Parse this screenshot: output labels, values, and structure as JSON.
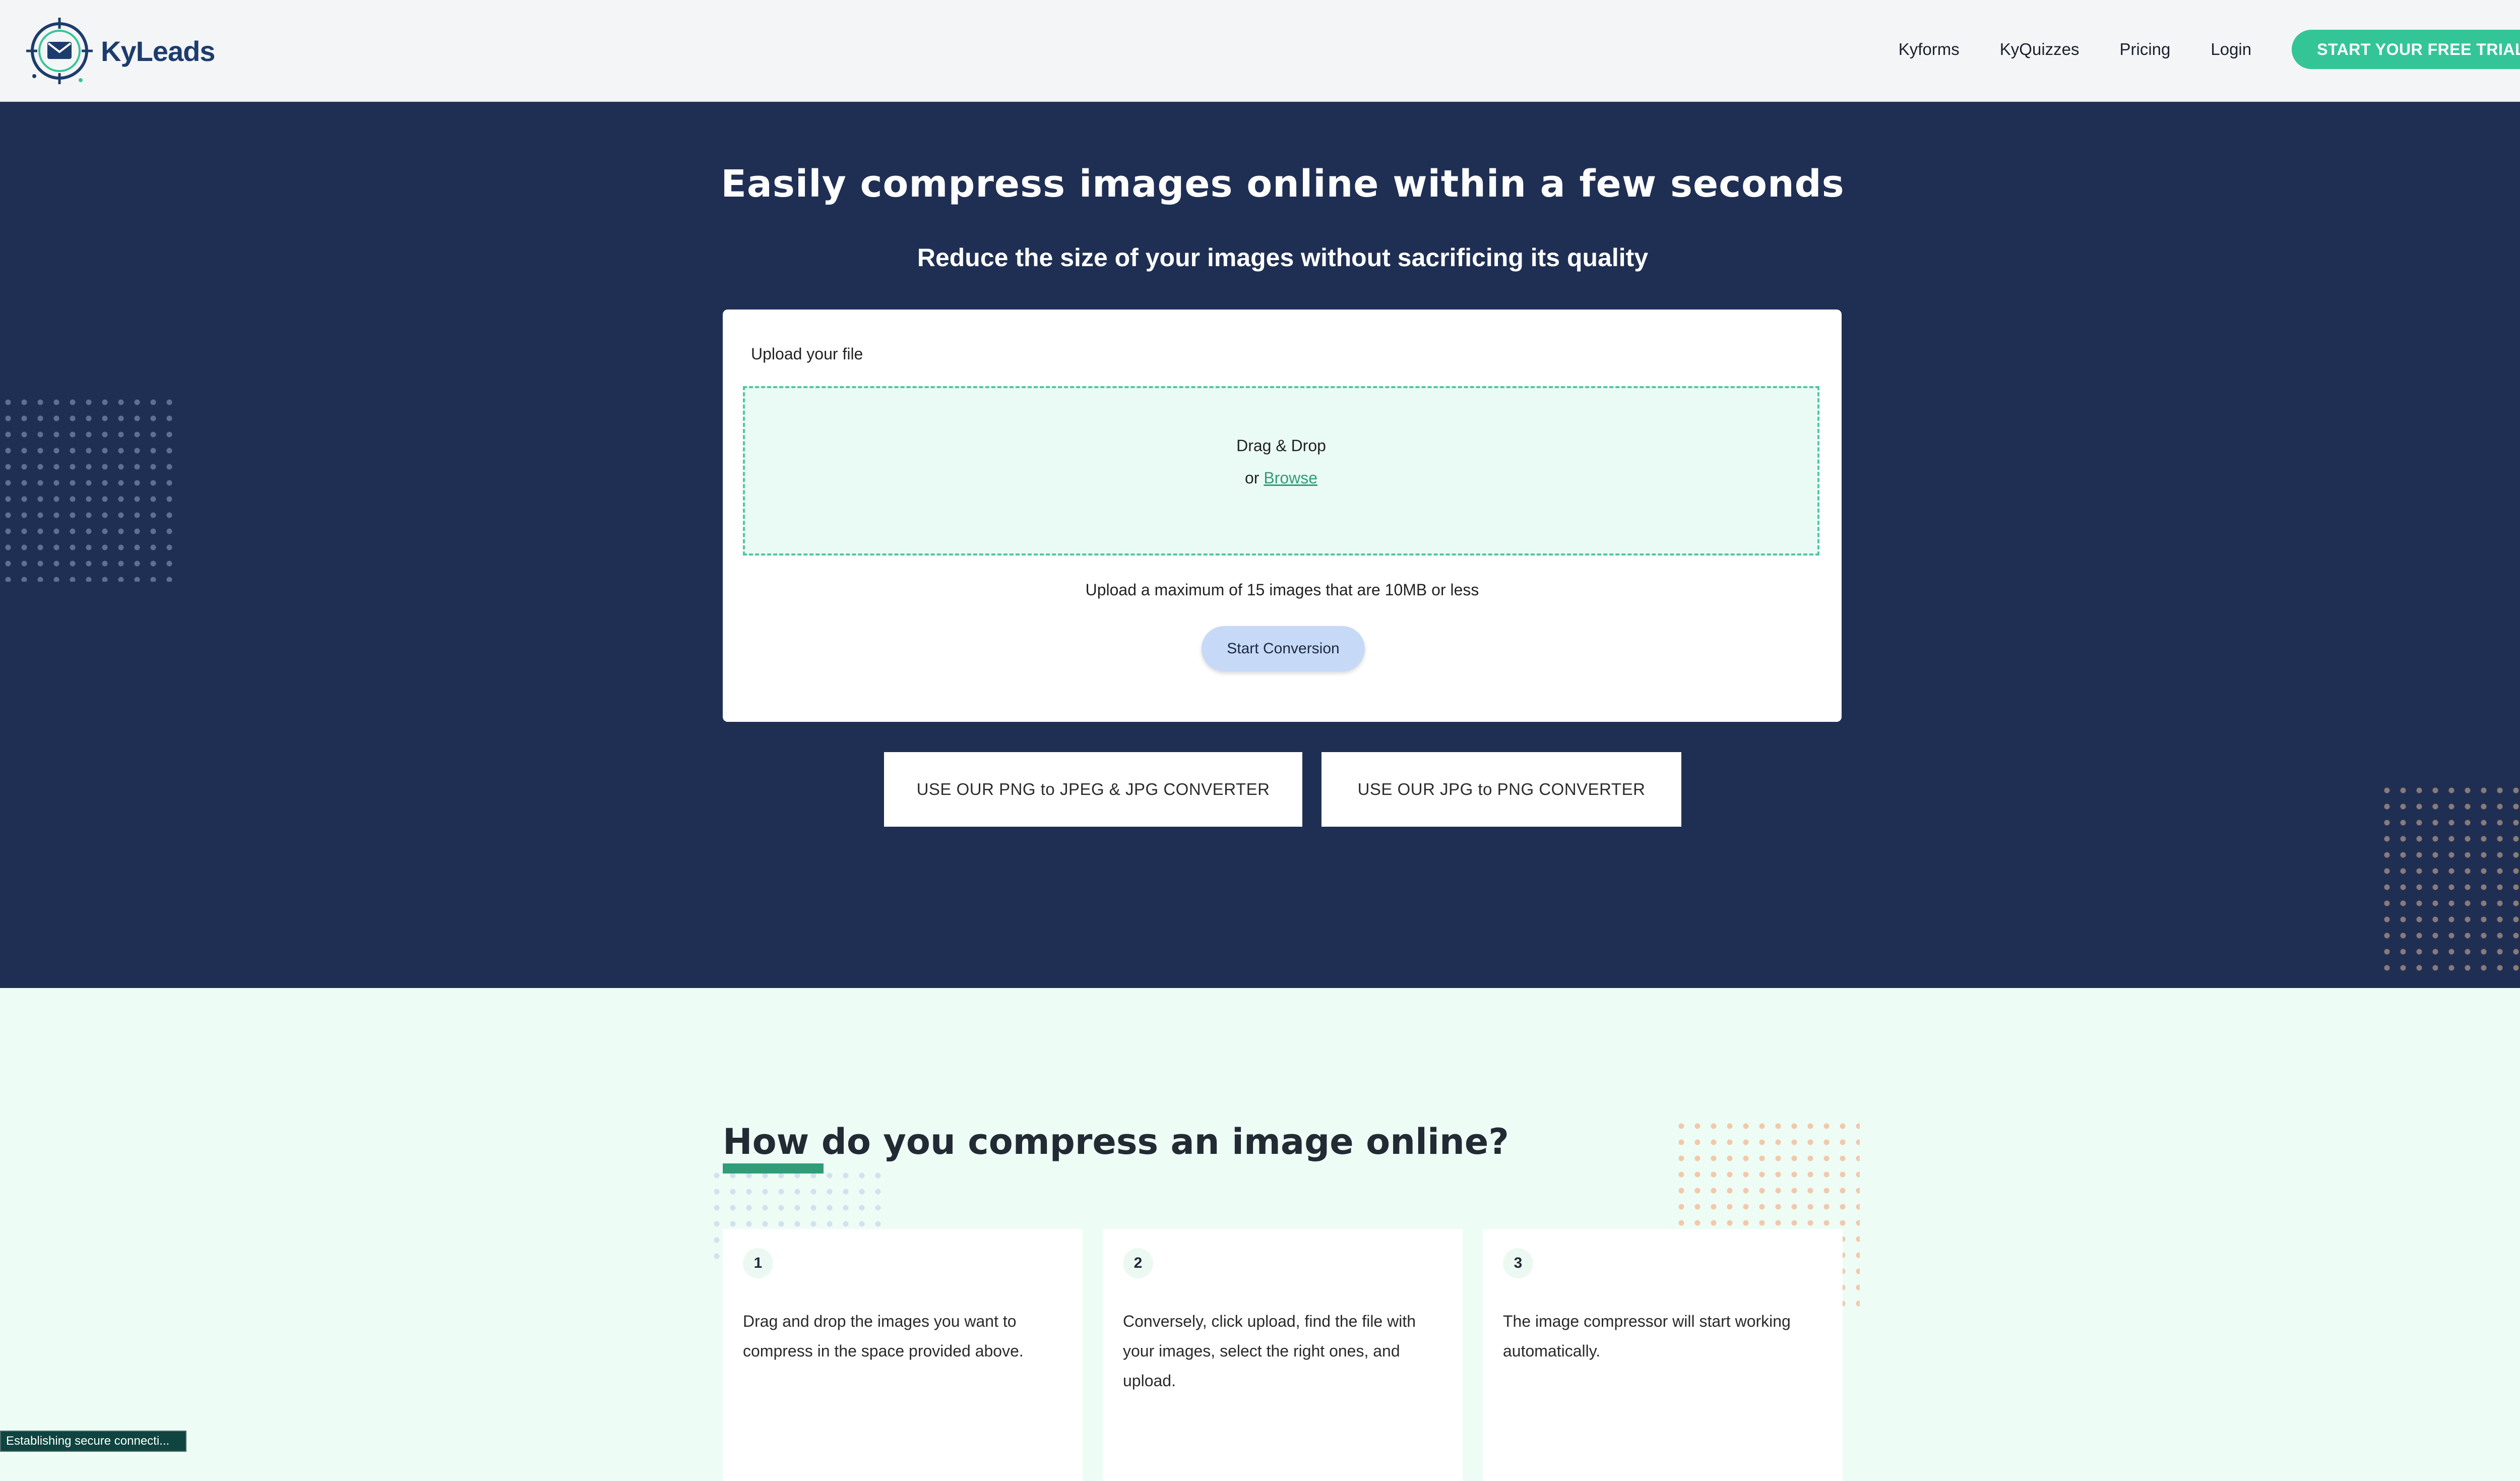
{
  "brand": {
    "name": "KyLeads",
    "logo_icon": "envelope-target-icon",
    "primary_color": "#1d3c6e"
  },
  "nav": {
    "items": [
      {
        "label": "Kyforms"
      },
      {
        "label": "KyQuizzes"
      },
      {
        "label": "Pricing"
      },
      {
        "label": "Login"
      }
    ],
    "cta_label": "START YOUR FREE TRIAL",
    "cta_color": "#34c597"
  },
  "hero": {
    "title": "Easily compress images online within a few seconds",
    "subtitle": "Reduce the size of your images without sacrificing its quality",
    "background_color": "#1f2f54"
  },
  "upload": {
    "label": "Upload your file",
    "drop_title": "Drag & Drop",
    "or_text": "or",
    "browse_label": "Browse",
    "note": "Upload a maximum of 15 images that are 10MB or less",
    "start_label": "Start Conversion"
  },
  "converters": {
    "png_label": "USE OUR PNG to JPEG & JPG CONVERTER",
    "jpg_label": "USE OUR JPG to PNG CONVERTER"
  },
  "howto": {
    "title": "How do you compress an image online?",
    "steps": [
      {
        "number": "1",
        "text": "Drag and drop the images you want to compress in the space provided above."
      },
      {
        "number": "2",
        "text": "Conversely, click upload, find the file with your images, select the right ones, and upload."
      },
      {
        "number": "3",
        "text": "The image compressor will start working automatically."
      }
    ]
  },
  "status": {
    "text": "Establishing secure connecti..."
  }
}
